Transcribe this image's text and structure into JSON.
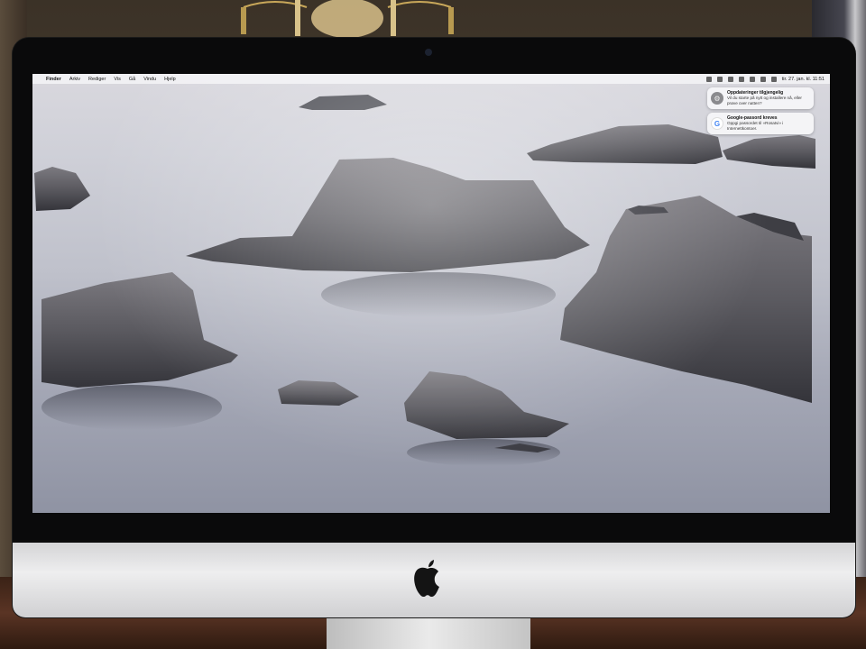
{
  "menubar": {
    "app_name": "Finder",
    "menus": [
      "Arkiv",
      "Rediger",
      "Vis",
      "Gå",
      "Vindu",
      "Hjelp"
    ],
    "clock": "tir. 27. jan. kl. 11:51"
  },
  "notifications": [
    {
      "icon": "gear-icon",
      "title": "Oppdateringer tilgjengelig",
      "body": "Vil du starte på nytt og installere nå, eller prøve over natten?"
    },
    {
      "icon": "google-icon",
      "title": "Google-passord kreves",
      "body": "Oppgi passordet til «Rosatvi» i Internettkontoer."
    }
  ],
  "colors": {
    "menubar": "#f5f5f8",
    "chin": "#eeeeef",
    "bezel": "#0a0a0b",
    "sea": "#bfc1cb",
    "rock": "#5b5a60"
  }
}
